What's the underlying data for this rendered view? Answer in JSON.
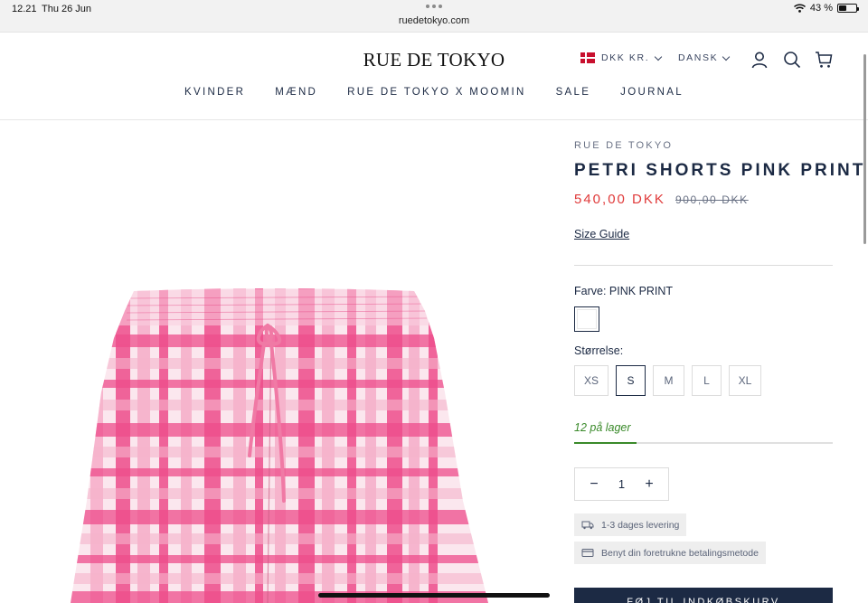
{
  "status_bar": {
    "time": "12.21",
    "date": "Thu 26 Jun",
    "url": "ruedetokyo.com",
    "battery": "43 %",
    "battery_level": 0.43
  },
  "header": {
    "logo": "RUE DE TOKYO",
    "currency": "DKK KR.",
    "language": "DANSK",
    "nav": [
      "KVINDER",
      "MÆND",
      "RUE DE TOKYO X MOOMIN",
      "SALE",
      "JOURNAL"
    ]
  },
  "product": {
    "brand": "RUE DE TOKYO",
    "title": "PETRI SHORTS PINK PRINT",
    "price": "540,00 DKK",
    "old_price": "900,00 DKK",
    "size_guide": "Size Guide",
    "color_label": "Farve:",
    "color_value": "PINK PRINT",
    "size_label": "Størrelse:",
    "sizes": [
      "XS",
      "S",
      "M",
      "L",
      "XL"
    ],
    "selected_size": "S",
    "stock_text": "12 på lager",
    "stock_level": 0.24,
    "quantity": "1",
    "delivery_text": "1-3 dages levering",
    "payment_text": "Benyt din foretrukne betalingsmetode",
    "add_to_cart": "FØJ TIL INDKØBSKURV"
  },
  "colors": {
    "navy": "#1c2a44",
    "sale_red": "#e03a3a",
    "stock_green": "#3a8a2a",
    "print_pink": "#ee4d8b"
  }
}
